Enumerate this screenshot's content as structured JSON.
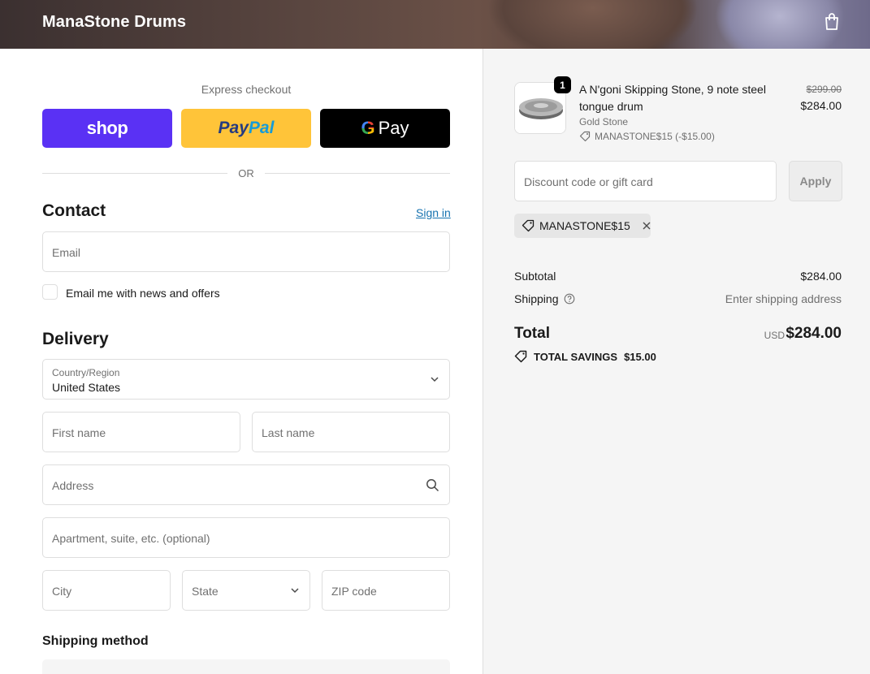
{
  "header": {
    "brand": "ManaStone Drums",
    "cart_icon": "shopping-bag-icon"
  },
  "express": {
    "title": "Express checkout",
    "shop_label": "shop",
    "paypal_label_1": "Pay",
    "paypal_label_2": "Pal",
    "gpay_g": "G",
    "gpay_label": "Pay",
    "or": "OR"
  },
  "contact": {
    "title": "Contact",
    "sign_in": "Sign in",
    "email_placeholder": "Email",
    "newsletter_label": "Email me with news and offers"
  },
  "delivery": {
    "title": "Delivery",
    "country_label": "Country/Region",
    "country_value": "United States",
    "first_name_placeholder": "First name",
    "last_name_placeholder": "Last name",
    "address_placeholder": "Address",
    "apartment_placeholder": "Apartment, suite, etc. (optional)",
    "city_placeholder": "City",
    "state_placeholder": "State",
    "zip_placeholder": "ZIP code"
  },
  "shipping_method": {
    "title": "Shipping method"
  },
  "order": {
    "item": {
      "quantity": "1",
      "name": "A N'goni Skipping Stone, 9 note steel tongue drum",
      "variant": "Gold Stone",
      "discount_code": "MANASTONE$15 (-$15.00)",
      "original_price": "$299.00",
      "price": "$284.00"
    },
    "discount": {
      "placeholder": "Discount code or gift card",
      "apply_label": "Apply",
      "applied_code": "MANASTONE$15"
    },
    "summary": {
      "subtotal_label": "Subtotal",
      "subtotal_value": "$284.00",
      "shipping_label": "Shipping",
      "shipping_value": "Enter shipping address",
      "total_label": "Total",
      "total_currency": "USD",
      "total_value": "$284.00",
      "savings_label": "TOTAL SAVINGS",
      "savings_value": "$15.00"
    }
  },
  "colors": {
    "shop_purple": "#5a31f4",
    "paypal_yellow": "#ffc439",
    "link_blue": "#1773b0",
    "summary_bg": "#f5f5f5"
  }
}
